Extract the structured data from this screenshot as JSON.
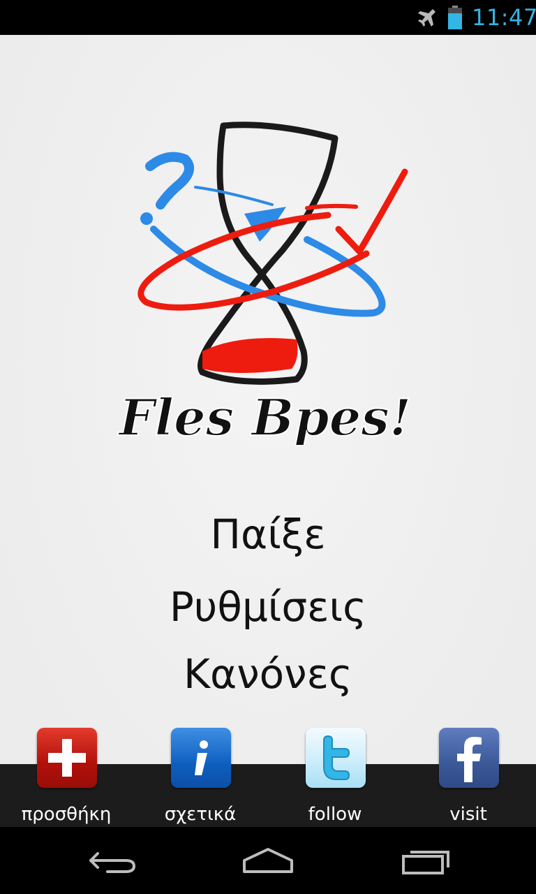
{
  "status_bar": {
    "time": "11:47",
    "icons": [
      "airplane-mode-icon",
      "battery-icon"
    ],
    "accent_color": "#33b5e5"
  },
  "logo": {
    "wordmark": "Fles Bpes!",
    "colors": {
      "red": "#ee1c0f",
      "blue": "#2d8ae6",
      "dark": "#1a1a1a"
    }
  },
  "menu": {
    "play": "Παίξε",
    "settings": "Ρυθμίσεις",
    "rules": "Κανόνες"
  },
  "bottom_buttons": [
    {
      "label": "προσθήκη",
      "icon": "plus-icon"
    },
    {
      "label": "σχετικά",
      "icon": "info-icon"
    },
    {
      "label": "follow",
      "icon": "twitter-icon"
    },
    {
      "label": "visit",
      "icon": "facebook-icon"
    }
  ],
  "nav_bar": {
    "icons": [
      "back-icon",
      "home-icon",
      "recent-apps-icon"
    ]
  }
}
